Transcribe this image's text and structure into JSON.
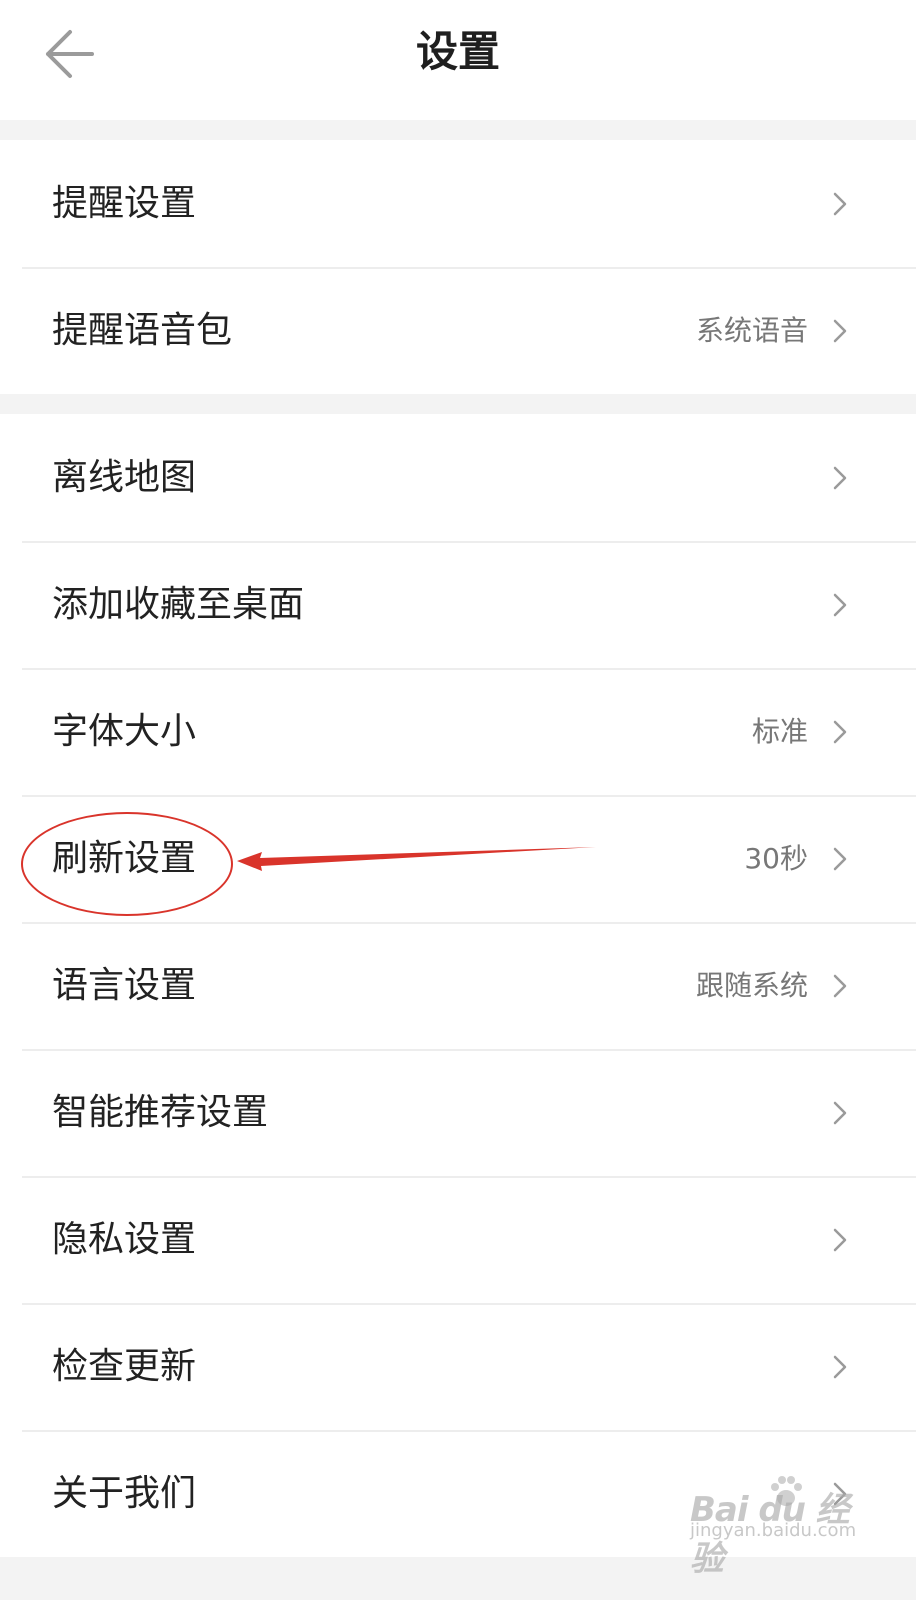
{
  "header": {
    "title": "设置",
    "back_icon": "arrow-left-icon"
  },
  "groups": [
    {
      "items": [
        {
          "label": "提醒设置",
          "value": ""
        },
        {
          "label": "提醒语音包",
          "value": "系统语音"
        }
      ]
    },
    {
      "items": [
        {
          "label": "离线地图",
          "value": ""
        },
        {
          "label": "添加收藏至桌面",
          "value": ""
        },
        {
          "label": "字体大小",
          "value": "标准"
        },
        {
          "label": "刷新设置",
          "value": "30秒"
        },
        {
          "label": "语言设置",
          "value": "跟随系统"
        },
        {
          "label": "智能推荐设置",
          "value": ""
        },
        {
          "label": "隐私设置",
          "value": ""
        },
        {
          "label": "检查更新",
          "value": ""
        },
        {
          "label": "关于我们",
          "value": ""
        }
      ]
    }
  ],
  "annotation": {
    "color": "#d9342b",
    "target": "刷新设置"
  },
  "watermark": {
    "logo": "Bai du 经验",
    "url": "jingyan.baidu.com"
  },
  "colors": {
    "background": "#f3f3f3",
    "surface": "#ffffff",
    "text": "#222222",
    "secondary_text": "#777777",
    "chevron": "#9a9a9a"
  }
}
